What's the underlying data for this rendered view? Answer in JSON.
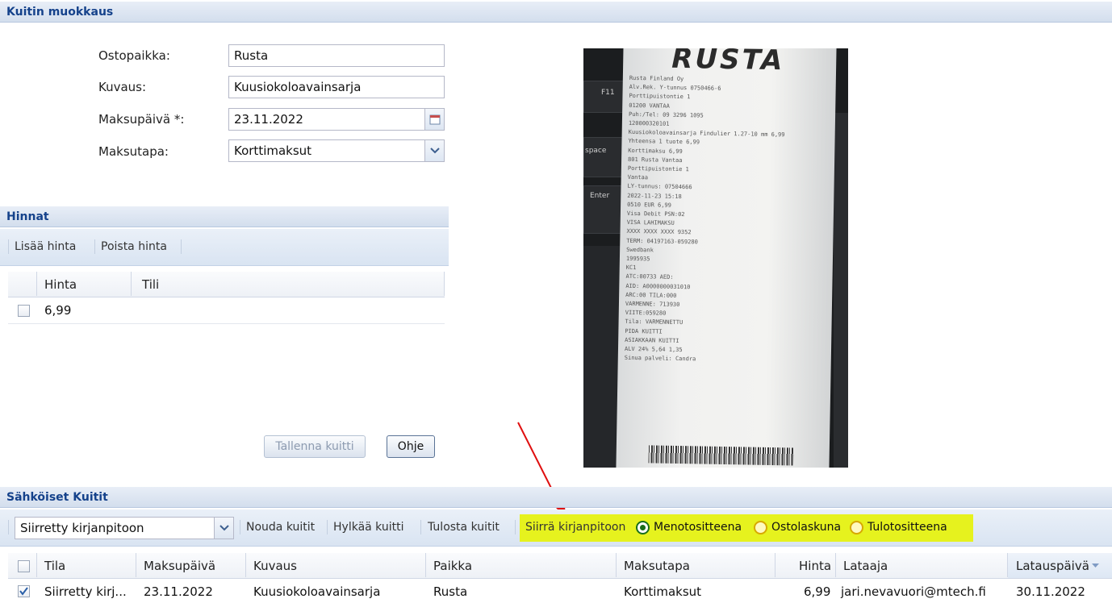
{
  "edit_panel": {
    "title": "Kuitin muokkaus",
    "fields": {
      "place": {
        "label": "Ostopaikka:",
        "value": "Rusta"
      },
      "description": {
        "label": "Kuvaus:",
        "value": "Kuusiokoloavainsarja"
      },
      "pay_date": {
        "label": "Maksupäivä *:",
        "value": "23.11.2022"
      },
      "pay_method": {
        "label": "Maksutapa:",
        "value": "Korttimaksut"
      }
    }
  },
  "prices_panel": {
    "title": "Hinnat",
    "toolbar": {
      "add": "Lisää hinta",
      "remove": "Poista hinta"
    },
    "columns": {
      "price": "Hinta",
      "account": "Tili"
    },
    "rows": [
      {
        "price": "6,99",
        "account": ""
      }
    ]
  },
  "buttons": {
    "save": "Tallenna kuitti",
    "help": "Ohje"
  },
  "receipt_image": {
    "store_logo": "RUSTA",
    "text_lines": [
      "Rusta Finland Oy",
      "Alv.Rek. Y-tunnus 0750466-6",
      "Porttipuistontie 1",
      "01200 VANTAA",
      "Puh:/Tel: 09 3296 1095",
      "120000320101",
      "Kuusiokoloavainsarja Findulier 1.27-10 mm  6,99",
      "Yhteensa 1 tuote  6,99",
      "Korttimaksu  6,99",
      "801 Rusta Vantaa",
      "Porttipuistontie 1",
      "Vantaa",
      "LY-tunnus: 07504666",
      "2022-11-23  15:18",
      "0510  EUR 6,99",
      "Visa Debit  PSN:02",
      "VISA LAHIMAKSU",
      "XXXX XXXX XXXX 9352",
      "TERM: 04197163-059280",
      "Swedbank",
      "1995935",
      "KC1",
      "ATC:00733  AED:",
      "AID: A0000000031010",
      "ARC:00  TILA:000",
      "VARMENNE:  713930",
      "VIITE:059280",
      "Tila:  VARMENNETTU",
      "PIDA KUITTI",
      "ASIAKKAAN KUITTI",
      "ALV 24%  5,64  1,35",
      "Sinua palveli: Candra"
    ],
    "keyboard_keys": [
      "F11",
      "space",
      "Enter"
    ]
  },
  "receipts_panel": {
    "title": "Sähköiset Kuitit",
    "toolbar": {
      "status_select": "Siirretty kirjanpitoon",
      "fetch": "Nouda kuitit",
      "reject": "Hylkää kuitti",
      "print": "Tulosta kuitit",
      "transfer": "Siirrä kirjanpitoon",
      "options": [
        {
          "label": "Menotositteena",
          "selected": true
        },
        {
          "label": "Ostolaskuna",
          "selected": false
        },
        {
          "label": "Tulotositteena",
          "selected": false
        }
      ]
    },
    "columns": {
      "status": "Tila",
      "pay_date": "Maksupäivä",
      "description": "Kuvaus",
      "place": "Paikka",
      "method": "Maksutapa",
      "price": "Hinta",
      "uploader": "Lataaja",
      "upload_date": "Latauspäivä"
    },
    "rows": [
      {
        "checked": true,
        "status": "Siirretty kirj...",
        "pay_date": "23.11.2022",
        "description": "Kuusiokoloavainsarja",
        "place": "Rusta",
        "method": "Korttimaksut",
        "price": "6,99",
        "uploader": "jari.nevavuori@mtech.fi",
        "upload_date": "30.11.2022"
      }
    ]
  },
  "colors": {
    "header_text": "#15428b",
    "highlight": "#e6f21e",
    "arrow": "#e01010"
  }
}
